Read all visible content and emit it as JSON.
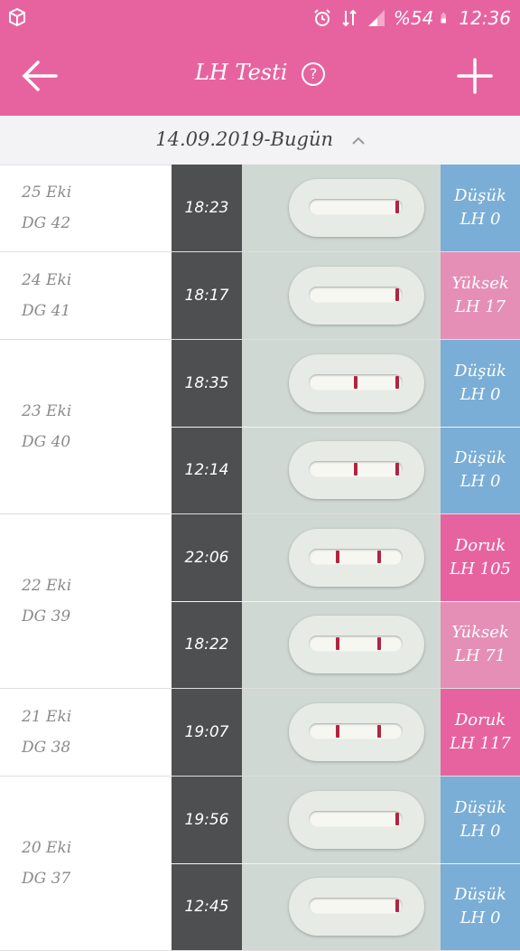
{
  "status_bar": {
    "battery": "%54",
    "time": "12:36",
    "icons": [
      "app-box-icon",
      "alarm-icon",
      "data-transfer-icon",
      "signal-icon",
      "battery-icon"
    ]
  },
  "app_bar": {
    "title": "LH Testi",
    "help_label": "?",
    "icons": [
      "back-arrow-icon",
      "help-icon",
      "add-icon"
    ]
  },
  "range": {
    "label": "14.09.2019-Bugün",
    "icon": "chevron-up-icon"
  },
  "colors": {
    "brand": "#e763a0",
    "low": "#7aaed6",
    "high": "#e58fb6",
    "peak": "#e763a0"
  },
  "days": [
    {
      "date": "25 Eki",
      "cycle_day": "DG 42",
      "tests": [
        {
          "time": "18:23",
          "level": "Düşük",
          "value": "LH 0",
          "kind": "low"
        }
      ]
    },
    {
      "date": "24 Eki",
      "cycle_day": "DG 41",
      "tests": [
        {
          "time": "18:17",
          "level": "Yüksek",
          "value": "LH 17",
          "kind": "high"
        }
      ]
    },
    {
      "date": "23 Eki",
      "cycle_day": "DG 40",
      "tests": [
        {
          "time": "18:35",
          "level": "Düşük",
          "value": "LH 0",
          "kind": "low"
        },
        {
          "time": "12:14",
          "level": "Düşük",
          "value": "LH 0",
          "kind": "low"
        }
      ]
    },
    {
      "date": "22 Eki",
      "cycle_day": "DG 39",
      "tests": [
        {
          "time": "22:06",
          "level": "Doruk",
          "value": "LH 105",
          "kind": "peak"
        },
        {
          "time": "18:22",
          "level": "Yüksek",
          "value": "LH 71",
          "kind": "high"
        }
      ]
    },
    {
      "date": "21 Eki",
      "cycle_day": "DG 38",
      "tests": [
        {
          "time": "19:07",
          "level": "Doruk",
          "value": "LH 117",
          "kind": "peak"
        }
      ]
    },
    {
      "date": "20 Eki",
      "cycle_day": "DG 37",
      "tests": [
        {
          "time": "19:56",
          "level": "Düşük",
          "value": "LH 0",
          "kind": "low"
        },
        {
          "time": "12:45",
          "level": "Düşük",
          "value": "LH 0",
          "kind": "low"
        }
      ]
    }
  ]
}
